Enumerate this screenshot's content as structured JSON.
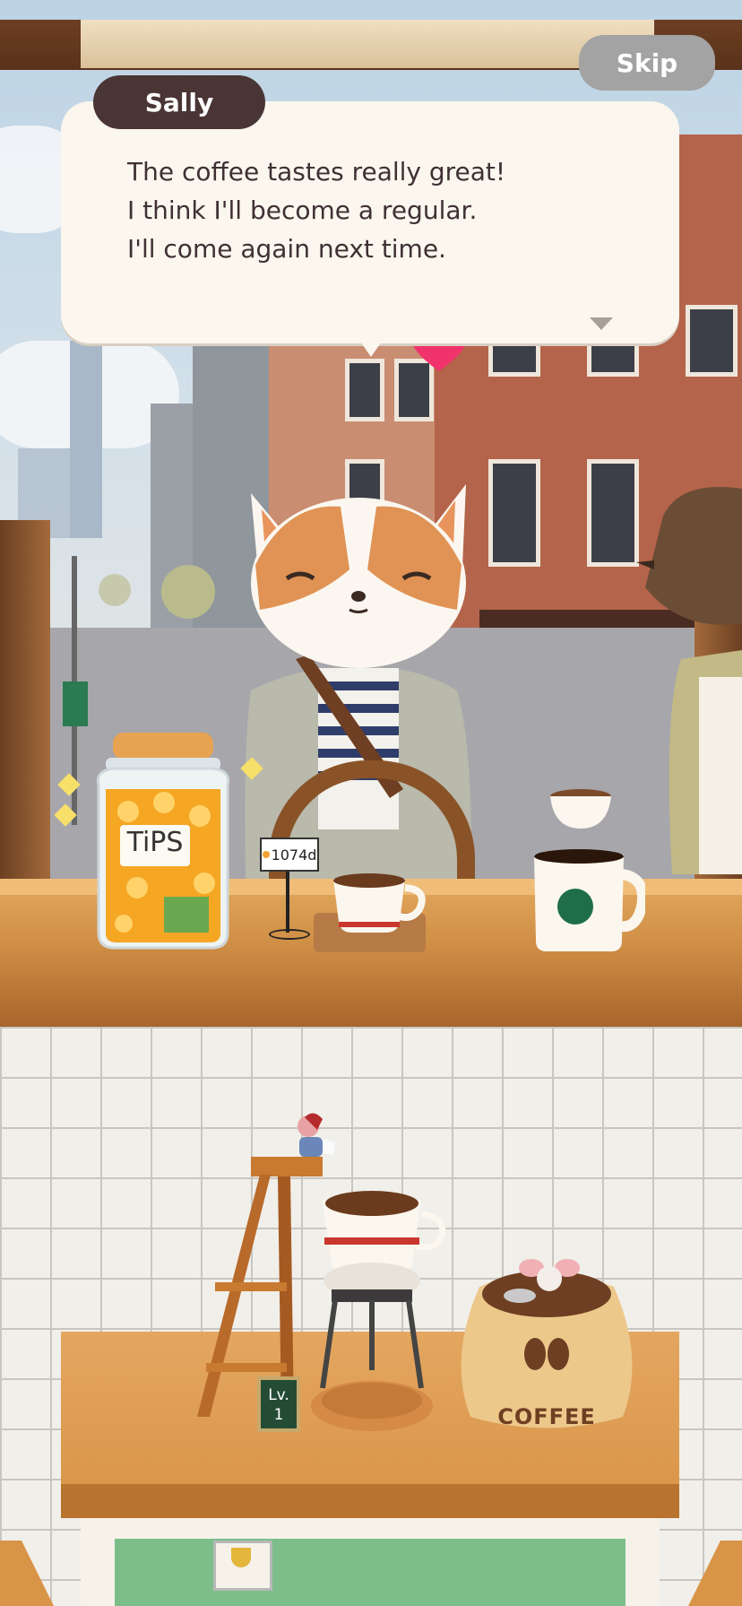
{
  "dialog": {
    "speaker": "Sally",
    "lines": [
      "The coffee tastes really great!",
      "I think I'll become a regular.",
      "I'll come again next time."
    ]
  },
  "controls": {
    "skip_label": "Skip"
  },
  "counter": {
    "jar_label": "TiPS",
    "tip_tag": "1074d"
  },
  "kitchen": {
    "level_label": "Lv.",
    "level_value": "1",
    "sack_label": "COFFEE"
  },
  "colors": {
    "dialog_bg": "#fbf6ee",
    "name_tag_bg": "#4a3535",
    "skip_bg": "#a3a3a3",
    "heart": "#f0336a"
  }
}
